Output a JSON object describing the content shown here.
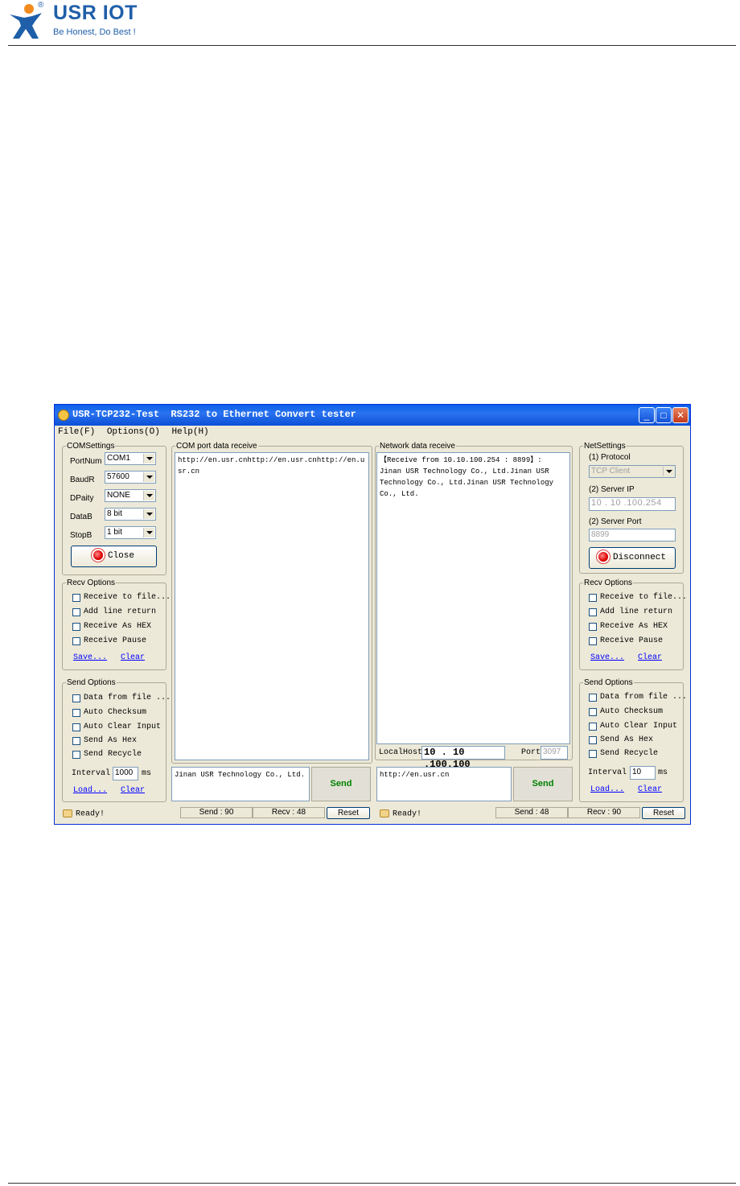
{
  "header": {
    "brand": "USR IOT",
    "reg": "®",
    "slogan": "Be Honest, Do Best !"
  },
  "window": {
    "title": "USR-TCP232-Test  RS232 to Ethernet Convert tester",
    "menu": [
      "File(F)",
      "Options(O)",
      "Help(H)"
    ]
  },
  "com_settings": {
    "legend": "COMSettings",
    "portnum_label": "PortNum",
    "portnum_value": "COM1",
    "baud_label": "BaudR",
    "baud_value": "57600",
    "parity_label": "DPaity",
    "parity_value": "NONE",
    "databits_label": "DataB",
    "databits_value": "8 bit",
    "stopbits_label": "StopB",
    "stopbits_value": "1 bit",
    "close_label": "Close"
  },
  "left_recv": {
    "legend": "Recv Options",
    "options": [
      "Receive to file...",
      "Add line return",
      "Receive As HEX",
      "Receive Pause"
    ],
    "save": "Save...",
    "clear": "Clear"
  },
  "left_send": {
    "legend": "Send Options",
    "options": [
      "Data from file ...",
      "Auto Checksum",
      "Auto Clear Input",
      "Send As Hex",
      "Send Recycle"
    ],
    "interval_label": "Interval",
    "interval_value": "1000",
    "interval_unit": "ms",
    "load": "Load...",
    "clear": "Clear"
  },
  "com_receive": {
    "legend": "COM port data receive",
    "text": "http://en.usr.cnhttp://en.usr.cnhttp://en.usr.cn"
  },
  "com_send": {
    "text": "Jinan USR Technology Co., Ltd.",
    "send_label": "Send"
  },
  "net_receive": {
    "legend": "Network data receive",
    "text": "【Receive from 10.10.100.254 : 8899】:\nJinan USR Technology Co., Ltd.Jinan USR Technology Co., Ltd.Jinan USR Technology Co., Ltd."
  },
  "localhost": {
    "label": "LocalHost",
    "ip": "10 . 10 .100.100",
    "port_label": "Port",
    "port_value": "3097"
  },
  "net_send": {
    "text": "http://en.usr.cn",
    "send_label": "Send"
  },
  "net_settings": {
    "legend": "NetSettings",
    "protocol_label": "(1) Protocol",
    "protocol_value": "TCP Client",
    "serverip_label": "(2) Server IP",
    "ip_parts": [
      "10",
      "10",
      "100",
      "254"
    ],
    "serverport_label": "(2) Server Port",
    "serverport_value": "8899",
    "disconnect_label": "Disconnect"
  },
  "right_recv": {
    "legend": "Recv Options",
    "options": [
      "Receive to file...",
      "Add line return",
      "Receive As HEX",
      "Receive Pause"
    ],
    "save": "Save...",
    "clear": "Clear"
  },
  "right_send": {
    "legend": "Send Options",
    "options": [
      "Data from file ...",
      "Auto Checksum",
      "Auto Clear Input",
      "Send As Hex",
      "Send Recycle"
    ],
    "interval_label": "Interval",
    "interval_value": "10",
    "interval_unit": "ms",
    "load": "Load...",
    "clear": "Clear"
  },
  "status_left": {
    "ready": "Ready!",
    "send": "Send : 90",
    "recv": "Recv : 48",
    "reset": "Reset"
  },
  "status_right": {
    "ready": "Ready!",
    "send": "Send : 48",
    "recv": "Recv : 90",
    "reset": "Reset"
  }
}
